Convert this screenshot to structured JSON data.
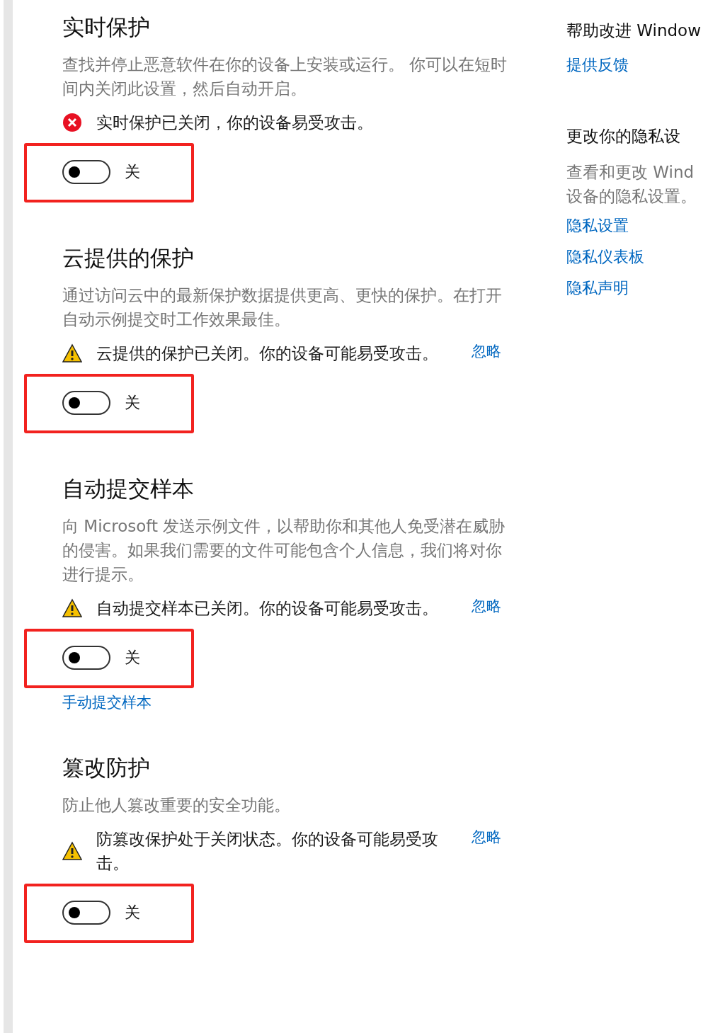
{
  "sections": [
    {
      "title": "实时保护",
      "description": "查找并停止恶意软件在你的设备上安装或运行。 你可以在短时间内关闭此设置，然后自动开启。",
      "alert": {
        "kind": "error",
        "text": "实时保护已关闭，你的设备易受攻击。"
      },
      "toggle": {
        "on": false,
        "label": "关"
      }
    },
    {
      "title": "云提供的保护",
      "description": "通过访问云中的最新保护数据提供更高、更快的保护。在打开自动示例提交时工作效果最佳。",
      "alert": {
        "kind": "warning",
        "text": "云提供的保护已关闭。你的设备可能易受攻击。",
        "dismiss": "忽略"
      },
      "toggle": {
        "on": false,
        "label": "关"
      }
    },
    {
      "title": "自动提交样本",
      "description": "向 Microsoft 发送示例文件，以帮助你和其他人免受潜在威胁的侵害。如果我们需要的文件可能包含个人信息，我们将对你进行提示。",
      "alert": {
        "kind": "warning",
        "text": "自动提交样本已关闭。你的设备可能易受攻击。",
        "dismiss": "忽略"
      },
      "toggle": {
        "on": false,
        "label": "关"
      },
      "link": "手动提交样本"
    },
    {
      "title": "篡改防护",
      "description": "防止他人篡改重要的安全功能。",
      "alert": {
        "kind": "warning",
        "text": "防篡改保护处于关闭状态。你的设备可能易受攻击。",
        "dismiss": "忽略"
      },
      "toggle": {
        "on": false,
        "label": "关"
      }
    }
  ],
  "side": [
    {
      "heading": "帮助改进 Window",
      "links": [
        "提供反馈"
      ]
    },
    {
      "heading": "更改你的隐私设",
      "description": "查看和更改 Wind 设备的隐私设置。",
      "links": [
        "隐私设置",
        "隐私仪表板",
        "隐私声明"
      ]
    }
  ]
}
